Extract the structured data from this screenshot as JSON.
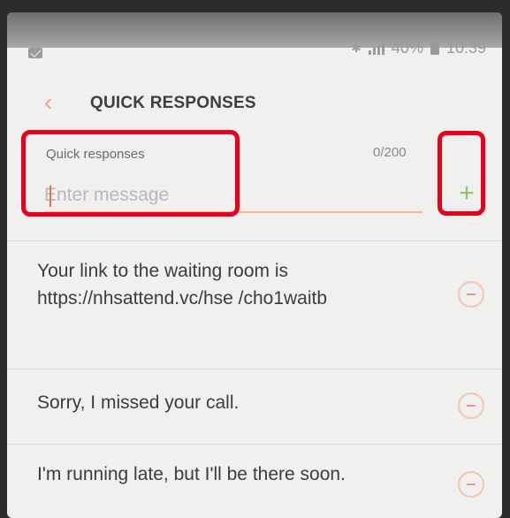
{
  "status_bar": {
    "battery_percent": "40%",
    "time": "10:39",
    "icons": [
      "mail-icon",
      "bluetooth-icon",
      "signal-icon",
      "battery-icon"
    ]
  },
  "app_bar": {
    "back_icon": "chevron-left-icon",
    "title": "QUICK RESPONSES"
  },
  "composer": {
    "label": "Quick responses",
    "counter": "0/200",
    "placeholder": "Enter message",
    "value": "",
    "add_icon": "plus-icon"
  },
  "responses": [
    {
      "text": "Your link to the waiting room is https://nhsattend.vc/hse /cho1waitb",
      "action_icon": "minus-circle-icon"
    },
    {
      "text": "Sorry, I missed your call.",
      "action_icon": "minus-circle-icon"
    },
    {
      "text": "I'm running late, but I'll be there soon.",
      "action_icon": "minus-circle-icon"
    }
  ],
  "colors": {
    "accent": "#e8743b",
    "add": "#8ac56c",
    "remove": "#ec9a84",
    "highlight": "#e8001c"
  }
}
